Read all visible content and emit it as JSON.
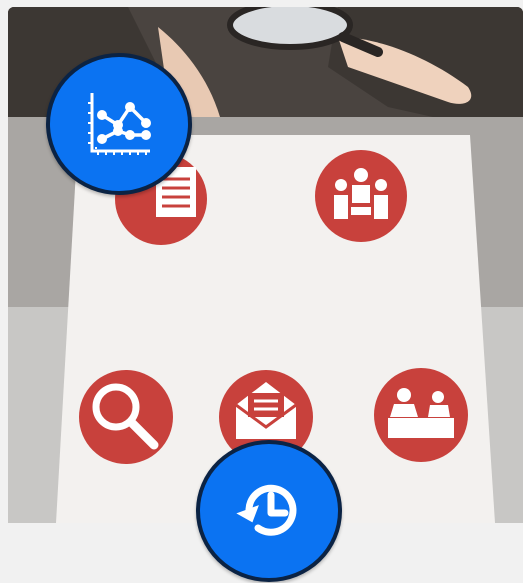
{
  "illustration": {
    "accent_color": "#c8413c",
    "paper_color": "#f2f0ee",
    "icons": [
      "document-search-icon",
      "meeting-people-icon",
      "magnifier-icon",
      "envelope-icon",
      "interview-desk-icon"
    ]
  },
  "actions": {
    "chart_button": {
      "icon": "line-chart-icon",
      "color": "#0b73f2"
    },
    "history_button": {
      "icon": "history-icon",
      "color": "#0b73f2"
    }
  }
}
